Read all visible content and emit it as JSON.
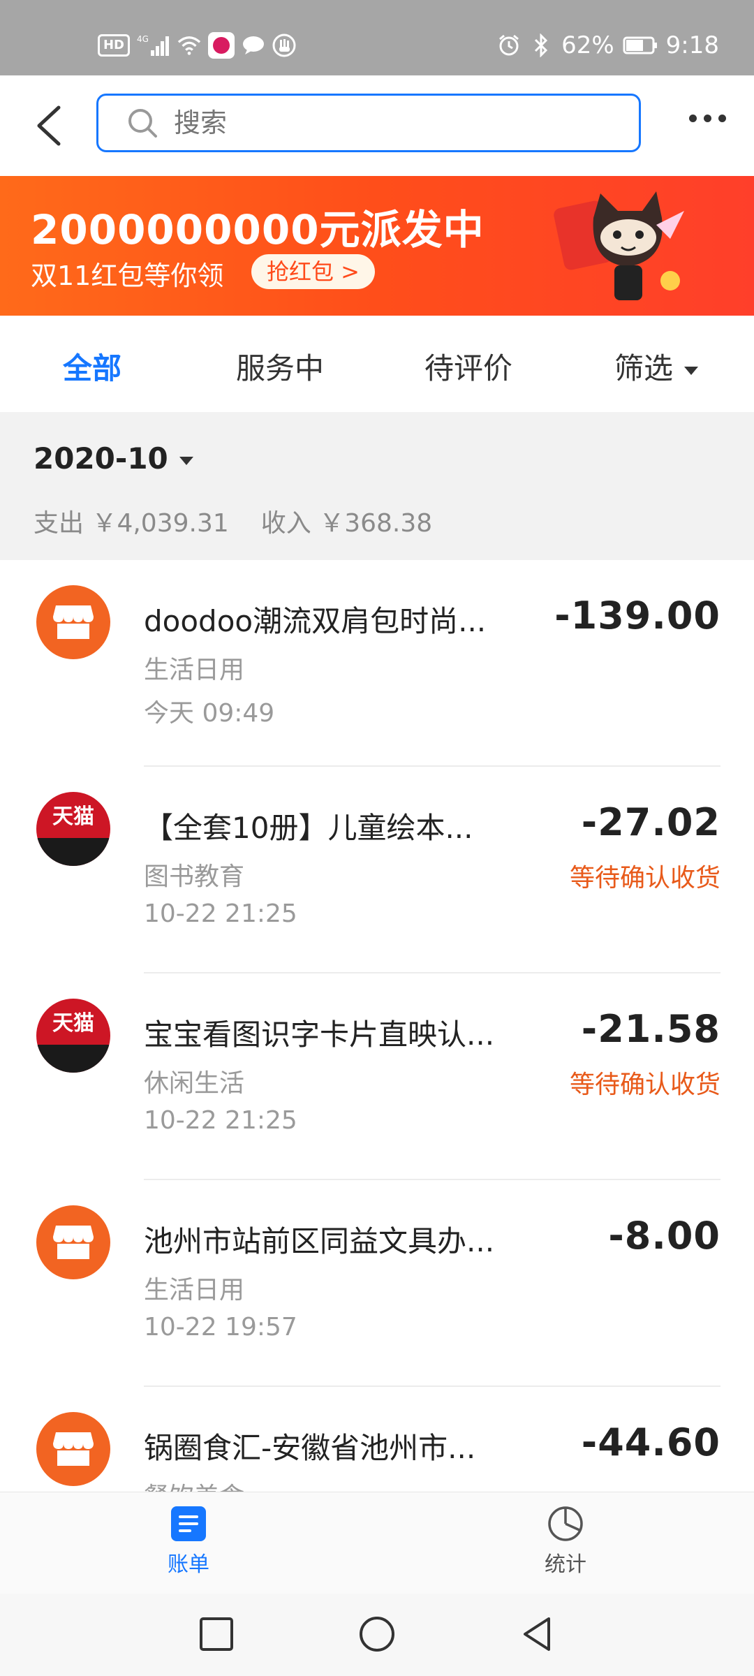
{
  "status_bar": {
    "left_icons": [
      "hd-icon",
      "signal-4g-icon",
      "wifi-icon",
      "app-icon",
      "chat-icon",
      "hand-icon"
    ],
    "hd": "HD",
    "network": "4G",
    "battery": "62%",
    "time": "9:18"
  },
  "header": {
    "search_placeholder": "搜索"
  },
  "banner": {
    "title": "2000000000元派发中",
    "subtitle": "双11红包等你领",
    "button": "抢红包 >"
  },
  "tabs": [
    {
      "label": "全部",
      "active": true
    },
    {
      "label": "服务中",
      "active": false
    },
    {
      "label": "待评价",
      "active": false
    },
    {
      "label": "筛选",
      "active": false
    }
  ],
  "summary": {
    "month": "2020-10",
    "expense": "支出 ￥4,039.31",
    "income": "收入 ￥368.38"
  },
  "transactions": [
    {
      "title": "doodoo潮流双肩包时尚...",
      "category": "生活日用",
      "time": "今天  09:49",
      "amount": "-139.00",
      "status": "",
      "icon": "store-icon"
    },
    {
      "title": "【全套10册】儿童绘本...",
      "category": "图书教育",
      "time": "10-22  21:25",
      "amount": "-27.02",
      "status": "等待确认收货",
      "icon": "tmall-icon",
      "icon_text": "天猫"
    },
    {
      "title": "宝宝看图识字卡片直映认...",
      "category": "休闲生活",
      "time": "10-22  21:25",
      "amount": "-21.58",
      "status": "等待确认收货",
      "icon": "tmall-icon",
      "icon_text": "天猫"
    },
    {
      "title": "池州市站前区同益文具办...",
      "category": "生活日用",
      "time": "10-22  19:57",
      "amount": "-8.00",
      "status": "",
      "icon": "store-icon"
    },
    {
      "title": "锅圈食汇-安徽省池州市...",
      "category": "餐饮美食",
      "time": "",
      "amount": "-44.60",
      "status": "",
      "icon": "store-icon"
    }
  ],
  "bottom_nav": [
    {
      "label": "账单",
      "icon": "bill-icon",
      "active": true
    },
    {
      "label": "统计",
      "icon": "pie-chart-icon",
      "active": false
    }
  ],
  "colors": {
    "accent": "#1677ff",
    "banner": "#ff5a1f",
    "store_icon": "#f26422",
    "tmall": "#cd1625",
    "status": "#e85a1a"
  }
}
